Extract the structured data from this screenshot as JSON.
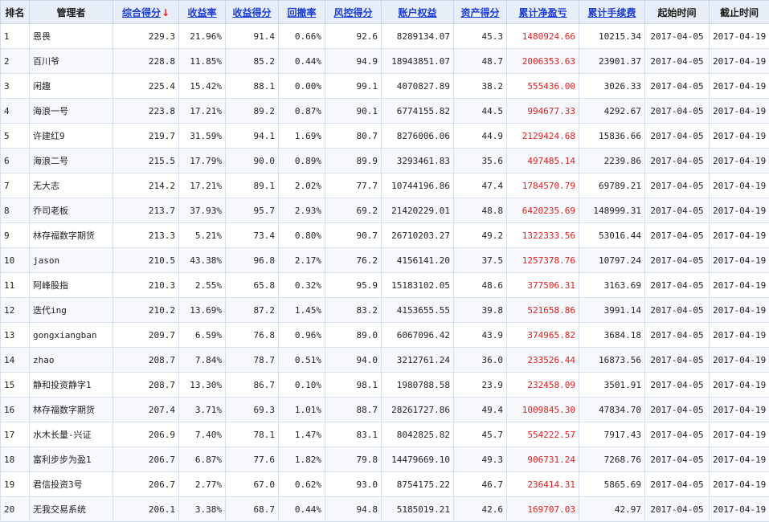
{
  "columns": [
    {
      "key": "rank",
      "label": "排名",
      "sortable": false
    },
    {
      "key": "manager",
      "label": "管理者",
      "sortable": false
    },
    {
      "key": "score",
      "label": "综合得分",
      "sortable": true,
      "sorted_desc": true
    },
    {
      "key": "return_rate",
      "label": "收益率",
      "sortable": true
    },
    {
      "key": "return_score",
      "label": "收益得分",
      "sortable": true
    },
    {
      "key": "drawdown",
      "label": "回撤率",
      "sortable": true
    },
    {
      "key": "risk_score",
      "label": "风控得分",
      "sortable": true
    },
    {
      "key": "equity",
      "label": "账户权益",
      "sortable": true
    },
    {
      "key": "asset_score",
      "label": "资产得分",
      "sortable": true
    },
    {
      "key": "net_profit",
      "label": "累计净盈亏",
      "sortable": true
    },
    {
      "key": "fees",
      "label": "累计手续费",
      "sortable": true
    },
    {
      "key": "start",
      "label": "起始时间",
      "sortable": false
    },
    {
      "key": "end",
      "label": "截止时间",
      "sortable": false
    }
  ],
  "sort_arrow": "↓",
  "colors": {
    "header_bg": "#e8eef8",
    "link": "#1a3bd6",
    "profit": "#e02020"
  },
  "rows": [
    {
      "rank": "1",
      "manager": "恩畏",
      "score": "229.3",
      "return_rate": "21.96%",
      "return_score": "91.4",
      "drawdown": "0.66%",
      "risk_score": "92.6",
      "equity": "8289134.07",
      "asset_score": "45.3",
      "net_profit": "1480924.66",
      "fees": "10215.34",
      "start": "2017-04-05",
      "end": "2017-04-19"
    },
    {
      "rank": "2",
      "manager": "百川爷",
      "score": "228.8",
      "return_rate": "11.85%",
      "return_score": "85.2",
      "drawdown": "0.44%",
      "risk_score": "94.9",
      "equity": "18943851.07",
      "asset_score": "48.7",
      "net_profit": "2006353.63",
      "fees": "23901.37",
      "start": "2017-04-05",
      "end": "2017-04-19"
    },
    {
      "rank": "3",
      "manager": "闲趣",
      "score": "225.4",
      "return_rate": "15.42%",
      "return_score": "88.1",
      "drawdown": "0.00%",
      "risk_score": "99.1",
      "equity": "4070827.89",
      "asset_score": "38.2",
      "net_profit": "555436.00",
      "fees": "3026.33",
      "start": "2017-04-05",
      "end": "2017-04-19"
    },
    {
      "rank": "4",
      "manager": "海浪一号",
      "score": "223.8",
      "return_rate": "17.21%",
      "return_score": "89.2",
      "drawdown": "0.87%",
      "risk_score": "90.1",
      "equity": "6774155.82",
      "asset_score": "44.5",
      "net_profit": "994677.33",
      "fees": "4292.67",
      "start": "2017-04-05",
      "end": "2017-04-19"
    },
    {
      "rank": "5",
      "manager": "许建红9",
      "score": "219.7",
      "return_rate": "31.59%",
      "return_score": "94.1",
      "drawdown": "1.69%",
      "risk_score": "80.7",
      "equity": "8276006.06",
      "asset_score": "44.9",
      "net_profit": "2129424.68",
      "fees": "15836.66",
      "start": "2017-04-05",
      "end": "2017-04-19"
    },
    {
      "rank": "6",
      "manager": "海浪二号",
      "score": "215.5",
      "return_rate": "17.79%",
      "return_score": "90.0",
      "drawdown": "0.89%",
      "risk_score": "89.9",
      "equity": "3293461.83",
      "asset_score": "35.6",
      "net_profit": "497485.14",
      "fees": "2239.86",
      "start": "2017-04-05",
      "end": "2017-04-19"
    },
    {
      "rank": "7",
      "manager": "无大志",
      "score": "214.2",
      "return_rate": "17.21%",
      "return_score": "89.1",
      "drawdown": "2.02%",
      "risk_score": "77.7",
      "equity": "10744196.86",
      "asset_score": "47.4",
      "net_profit": "1784570.79",
      "fees": "69789.21",
      "start": "2017-04-05",
      "end": "2017-04-19"
    },
    {
      "rank": "8",
      "manager": "乔司老板",
      "score": "213.7",
      "return_rate": "37.93%",
      "return_score": "95.7",
      "drawdown": "2.93%",
      "risk_score": "69.2",
      "equity": "21420229.01",
      "asset_score": "48.8",
      "net_profit": "6420235.69",
      "fees": "148999.31",
      "start": "2017-04-05",
      "end": "2017-04-19"
    },
    {
      "rank": "9",
      "manager": "林存福数字期货",
      "score": "213.3",
      "return_rate": "5.21%",
      "return_score": "73.4",
      "drawdown": "0.80%",
      "risk_score": "90.7",
      "equity": "26710203.27",
      "asset_score": "49.2",
      "net_profit": "1322333.56",
      "fees": "53016.44",
      "start": "2017-04-05",
      "end": "2017-04-19"
    },
    {
      "rank": "10",
      "manager": "jason",
      "score": "210.5",
      "return_rate": "43.38%",
      "return_score": "96.8",
      "drawdown": "2.17%",
      "risk_score": "76.2",
      "equity": "4156141.20",
      "asset_score": "37.5",
      "net_profit": "1257378.76",
      "fees": "10797.24",
      "start": "2017-04-05",
      "end": "2017-04-19"
    },
    {
      "rank": "11",
      "manager": "阿峰股指",
      "score": "210.3",
      "return_rate": "2.55%",
      "return_score": "65.8",
      "drawdown": "0.32%",
      "risk_score": "95.9",
      "equity": "15183102.05",
      "asset_score": "48.6",
      "net_profit": "377506.31",
      "fees": "3163.69",
      "start": "2017-04-05",
      "end": "2017-04-19"
    },
    {
      "rank": "12",
      "manager": "迭代ing",
      "score": "210.2",
      "return_rate": "13.69%",
      "return_score": "87.2",
      "drawdown": "1.45%",
      "risk_score": "83.2",
      "equity": "4153655.55",
      "asset_score": "39.8",
      "net_profit": "521658.86",
      "fees": "3991.14",
      "start": "2017-04-05",
      "end": "2017-04-19"
    },
    {
      "rank": "13",
      "manager": "gongxiangban",
      "score": "209.7",
      "return_rate": "6.59%",
      "return_score": "76.8",
      "drawdown": "0.96%",
      "risk_score": "89.0",
      "equity": "6067096.42",
      "asset_score": "43.9",
      "net_profit": "374965.82",
      "fees": "3684.18",
      "start": "2017-04-05",
      "end": "2017-04-19"
    },
    {
      "rank": "14",
      "manager": "zhao",
      "score": "208.7",
      "return_rate": "7.84%",
      "return_score": "78.7",
      "drawdown": "0.51%",
      "risk_score": "94.0",
      "equity": "3212761.24",
      "asset_score": "36.0",
      "net_profit": "233526.44",
      "fees": "16873.56",
      "start": "2017-04-05",
      "end": "2017-04-19"
    },
    {
      "rank": "15",
      "manager": "静和投资静字1",
      "score": "208.7",
      "return_rate": "13.30%",
      "return_score": "86.7",
      "drawdown": "0.10%",
      "risk_score": "98.1",
      "equity": "1980788.58",
      "asset_score": "23.9",
      "net_profit": "232458.09",
      "fees": "3501.91",
      "start": "2017-04-05",
      "end": "2017-04-19"
    },
    {
      "rank": "16",
      "manager": "林存福数字期货",
      "score": "207.4",
      "return_rate": "3.71%",
      "return_score": "69.3",
      "drawdown": "1.01%",
      "risk_score": "88.7",
      "equity": "28261727.86",
      "asset_score": "49.4",
      "net_profit": "1009845.30",
      "fees": "47834.70",
      "start": "2017-04-05",
      "end": "2017-04-19"
    },
    {
      "rank": "17",
      "manager": "水木长量-兴证",
      "score": "206.9",
      "return_rate": "7.40%",
      "return_score": "78.1",
      "drawdown": "1.47%",
      "risk_score": "83.1",
      "equity": "8042825.82",
      "asset_score": "45.7",
      "net_profit": "554222.57",
      "fees": "7917.43",
      "start": "2017-04-05",
      "end": "2017-04-19"
    },
    {
      "rank": "18",
      "manager": "富利步步为盈1",
      "score": "206.7",
      "return_rate": "6.87%",
      "return_score": "77.6",
      "drawdown": "1.82%",
      "risk_score": "79.8",
      "equity": "14479669.10",
      "asset_score": "49.3",
      "net_profit": "906731.24",
      "fees": "7268.76",
      "start": "2017-04-05",
      "end": "2017-04-19"
    },
    {
      "rank": "19",
      "manager": "君信投资3号",
      "score": "206.7",
      "return_rate": "2.77%",
      "return_score": "67.0",
      "drawdown": "0.62%",
      "risk_score": "93.0",
      "equity": "8754175.22",
      "asset_score": "46.7",
      "net_profit": "236414.31",
      "fees": "5865.69",
      "start": "2017-04-05",
      "end": "2017-04-19"
    },
    {
      "rank": "20",
      "manager": "无我交易系统",
      "score": "206.1",
      "return_rate": "3.38%",
      "return_score": "68.7",
      "drawdown": "0.44%",
      "risk_score": "94.8",
      "equity": "5185019.21",
      "asset_score": "42.6",
      "net_profit": "169707.03",
      "fees": "42.97",
      "start": "2017-04-05",
      "end": "2017-04-19"
    }
  ]
}
